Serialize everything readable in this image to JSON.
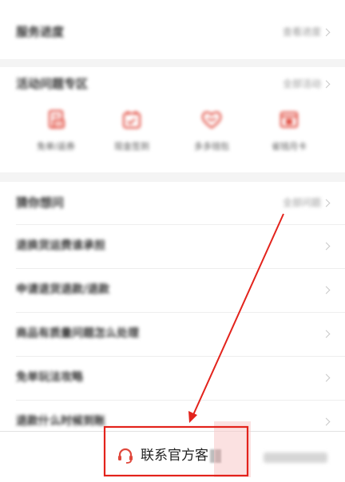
{
  "service_progress": {
    "title": "服务进度",
    "link": "查看进度"
  },
  "activity": {
    "title": "活动问题专区",
    "link": "全部活动",
    "items": [
      {
        "label": "免单/返券",
        "icon": "receipt-icon"
      },
      {
        "label": "现金签到",
        "icon": "calendar-icon"
      },
      {
        "label": "多多钱包",
        "icon": "heart-icon"
      },
      {
        "label": "省钱月卡",
        "icon": "card-icon"
      }
    ]
  },
  "faq": {
    "title": "猜你想问",
    "link": "全部问题",
    "questions": [
      "退换货运费谁承担",
      "申请退货退款/退款",
      "商品有质量问题怎么处理",
      "免单玩法攻略",
      "退款什么时候到账"
    ]
  },
  "bottom_bar": {
    "contact_label": "联系官方客",
    "contact_icon": "headset-icon"
  },
  "colors": {
    "accent": "#e0483c",
    "annotation": "#e3231c",
    "background": "#f4f4f4"
  }
}
